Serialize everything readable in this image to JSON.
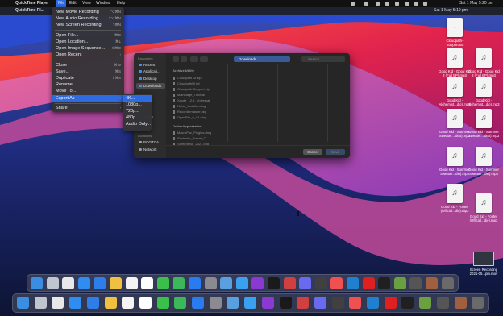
{
  "menubar": {
    "app_name": "QuickTime Player",
    "menus": [
      "File",
      "Edit",
      "View",
      "Window",
      "Help"
    ],
    "clock": "Sat 1 May  5:20 pm"
  },
  "menubar_secondary": {
    "app_name": "QuickTime Pl...",
    "clock": "Sat 1 May  5:19 pm"
  },
  "file_menu": {
    "items": [
      {
        "label": "New Movie Recording",
        "shortcut": "⌥⌘N",
        "arrow": ""
      },
      {
        "label": "New Audio Recording",
        "shortcut": "^⌥⌘N",
        "arrow": ""
      },
      {
        "label": "New Screen Recording",
        "shortcut": "^⌘N",
        "arrow": ""
      },
      {
        "label": "Open File...",
        "shortcut": "⌘O",
        "arrow": ""
      },
      {
        "label": "Open Location...",
        "shortcut": "⌘L",
        "arrow": ""
      },
      {
        "label": "Open Image Sequence...",
        "shortcut": "⇧⌘O",
        "arrow": ""
      },
      {
        "label": "Open Recent",
        "shortcut": "",
        "arrow": "›"
      },
      {
        "label": "Close",
        "shortcut": "⌘W",
        "arrow": ""
      },
      {
        "label": "Save...",
        "shortcut": "⌘S",
        "arrow": ""
      },
      {
        "label": "Duplicate",
        "shortcut": "⇧⌘S",
        "arrow": ""
      },
      {
        "label": "Rename...",
        "shortcut": "",
        "arrow": ""
      },
      {
        "label": "Move To...",
        "shortcut": "",
        "arrow": ""
      },
      {
        "label": "Export As",
        "shortcut": "",
        "arrow": "›"
      },
      {
        "label": "Share",
        "shortcut": "",
        "arrow": "›"
      }
    ],
    "highlighted": "Export As"
  },
  "export_submenu": {
    "items": [
      "4K...",
      "1080p...",
      "720p...",
      "480p...",
      "Audio Only..."
    ],
    "highlighted": "4K..."
  },
  "save_dialog": {
    "location": "Downloads",
    "search_placeholder": "Search",
    "sidebar": {
      "favourites_header": "Favourites",
      "items": [
        "Recent",
        "Applicati...",
        "Desktop",
        "Downloads"
      ],
      "selected": "Downloads",
      "partial_items": [
        "Time",
        "ts",
        "ments",
        "ds"
      ],
      "locations_header": "Locations",
      "locations": [
        "BOOTCA...",
        "Network"
      ]
    },
    "column1": {
      "header": "Archive Utility",
      "files": [
        "Cloudpath UI.zip",
        "CloudpathUI.txt",
        "Cloudpath-Support.zip",
        "Mainstage_Tutorial",
        "Xcode_12.5_Universal",
        "Noise_Installer.dmg",
        "Recordermaster.pkg",
        "OpenFile_6_14.dmg"
      ],
      "header2": "OnlineAppInstaller",
      "files2": [
        "MacroPac_Plugins.dmg",
        "Illustrator_Preset_C",
        "Screenshot_2021.png"
      ]
    },
    "cancel_label": "Cancel",
    "save_label": "Save"
  },
  "desktop_icons": [
    {
      "label": "Cloudpath-Support.txt",
      "kind": "txt"
    },
    {
      "label": "Good Kid - Good Kid 2 (Full EP).mp3",
      "kind": "audio"
    },
    {
      "label": "Good Kid - Good Kid 2 (Full EP).mp3",
      "kind": "audio"
    },
    {
      "label": "Good Kid - Alchemist...dio).mp3",
      "kind": "audio"
    },
    {
      "label": "Good Kid - Alchemist...dio).mp3",
      "kind": "audio"
    },
    {
      "label": "Good Kid - Summer Sweater...ideo).mp3",
      "kind": "audio"
    },
    {
      "label": "Good Kid - Summer Sweater...ideo).mp3",
      "kind": "audio"
    },
    {
      "label": "Good Kid - Summer Sweater...dio).mp3",
      "kind": "audio"
    },
    {
      "label": "Good Kid - Summer Sweater...dio).mp3",
      "kind": "audio"
    },
    {
      "label": "Good Kid - Foster (Official...dio).mp3",
      "kind": "audio"
    },
    {
      "label": "Good Kid - Foster (Official...dio).mp3",
      "kind": "audio"
    },
    {
      "label": "Screen Recording 2021-05...pm.mov",
      "kind": "video"
    }
  ],
  "dock_icons": [
    "finder-icon",
    "launchpad-icon",
    "chrome-icon",
    "safari-icon",
    "mail-icon",
    "notes-icon",
    "photos-icon",
    "calendar-icon",
    "messages-icon",
    "facetime-icon",
    "appstore-icon",
    "settings-icon",
    "preview-icon",
    "xcode-icon",
    "podcasts-icon",
    "quicktime-icon",
    "istat-icon",
    "imovie-icon",
    "finalcut-icon",
    "capture-icon",
    "screenflow-icon",
    "youtube-icon",
    "tv-icon",
    "minecraft-icon",
    "sysmon-icon",
    "script-icon",
    "trash-icon"
  ],
  "colors": {
    "accent": "#2e6be0",
    "menu_bg": "#343438",
    "dialog_bg": "#262626"
  }
}
